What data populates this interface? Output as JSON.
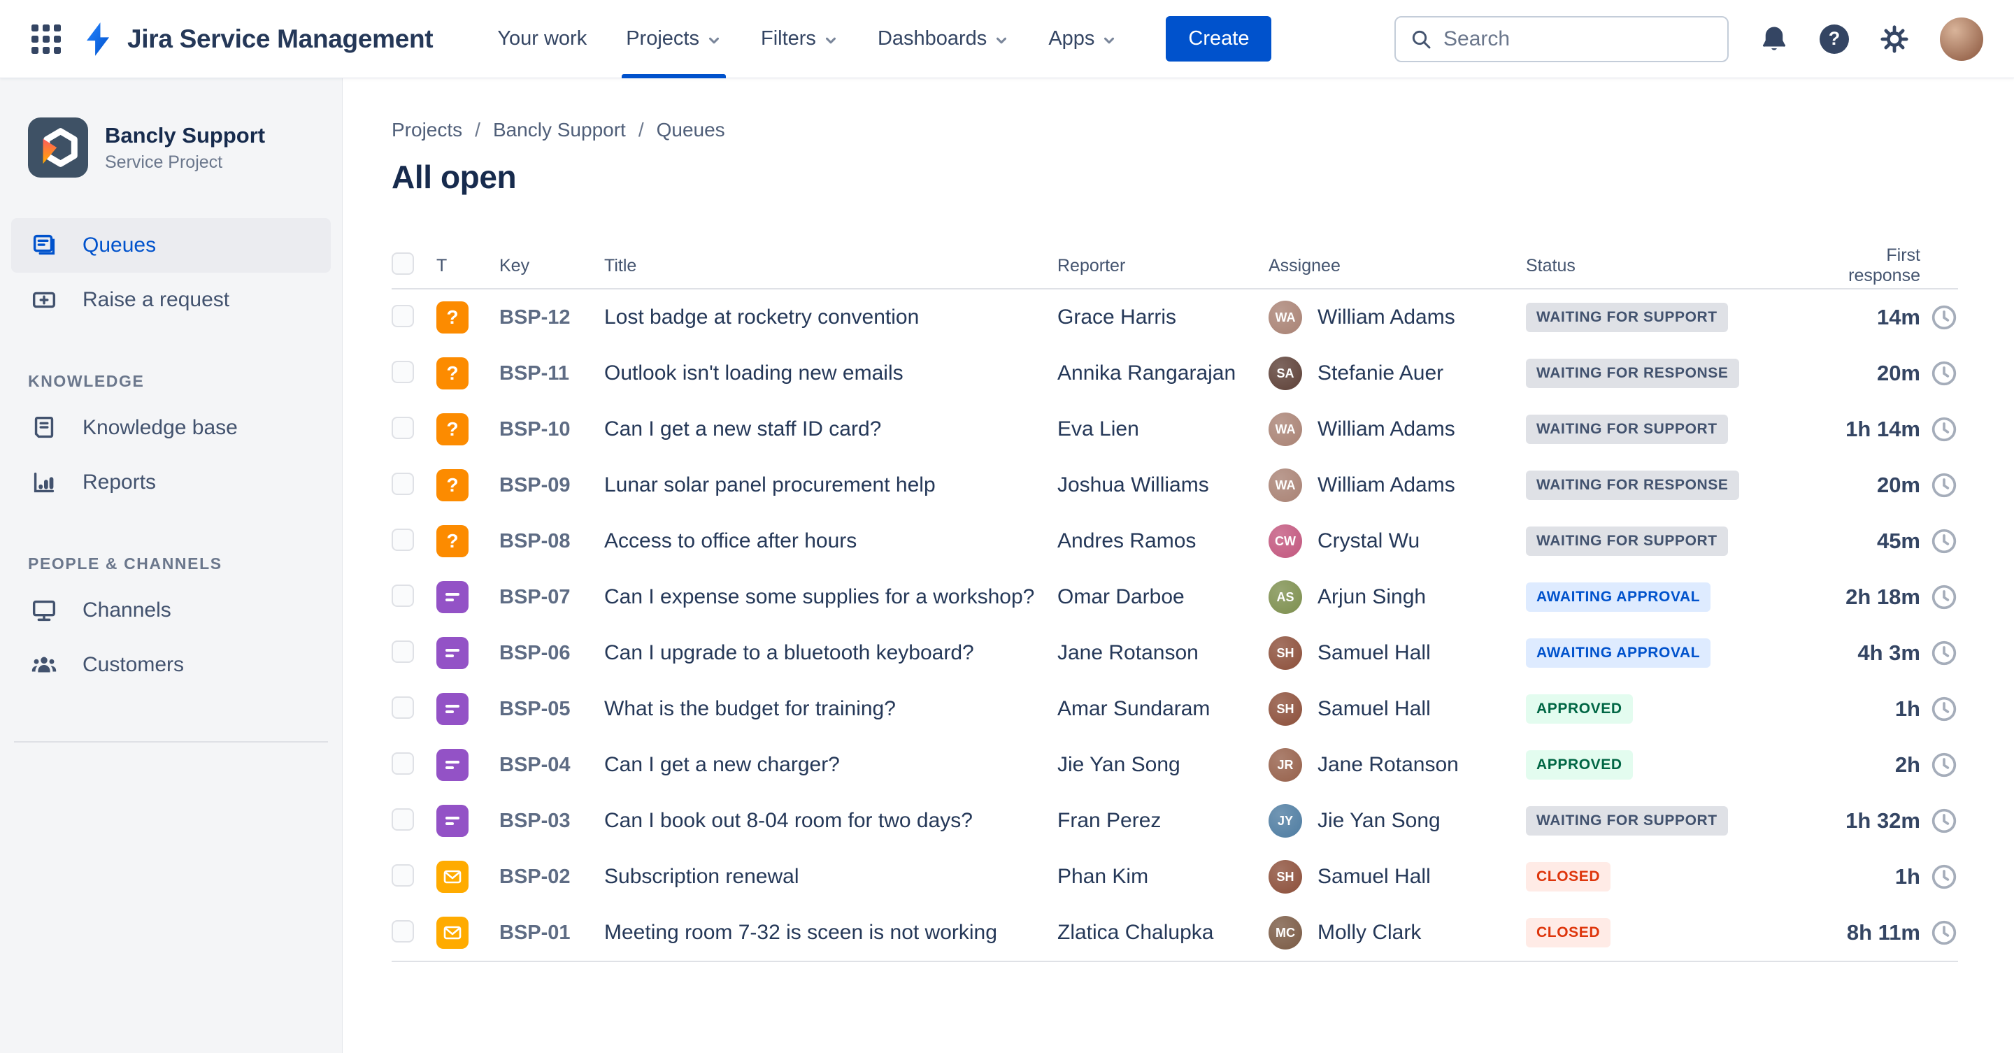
{
  "header": {
    "product": "Jira Service Management",
    "nav": [
      {
        "label": "Your work",
        "chevron": false,
        "active": false
      },
      {
        "label": "Projects",
        "chevron": true,
        "active": true
      },
      {
        "label": "Filters",
        "chevron": true,
        "active": false
      },
      {
        "label": "Dashboards",
        "chevron": true,
        "active": false
      },
      {
        "label": "Apps",
        "chevron": true,
        "active": false
      }
    ],
    "create_label": "Create",
    "search": {
      "placeholder": "Search"
    },
    "icons": [
      "app-switcher-icon",
      "jira-logo",
      "search-icon",
      "notifications-bell-icon",
      "help-icon",
      "settings-gear-icon",
      "user-avatar"
    ]
  },
  "sidebar": {
    "project": {
      "name": "Bancly Support",
      "type": "Service Project"
    },
    "sections": [
      {
        "header": "",
        "items": [
          {
            "label": "Queues",
            "icon": "queues-icon",
            "active": true
          },
          {
            "label": "Raise a request",
            "icon": "raise-request-icon",
            "active": false
          }
        ]
      },
      {
        "header": "KNOWLEDGE",
        "items": [
          {
            "label": "Knowledge base",
            "icon": "knowledge-base-icon",
            "active": false
          },
          {
            "label": "Reports",
            "icon": "reports-icon",
            "active": false
          }
        ]
      },
      {
        "header": "PEOPLE & CHANNELS",
        "items": [
          {
            "label": "Channels",
            "icon": "channels-icon",
            "active": false
          },
          {
            "label": "Customers",
            "icon": "customers-icon",
            "active": false
          }
        ]
      }
    ]
  },
  "main": {
    "breadcrumb": [
      "Projects",
      "Bancly Support",
      "Queues"
    ],
    "title": "All open",
    "table": {
      "columns": [
        "T",
        "Key",
        "Title",
        "Reporter",
        "Assignee",
        "Status",
        "First response"
      ],
      "rows": [
        {
          "type": "question",
          "key": "BSP-12",
          "title": "Lost badge at rocketry convention",
          "reporter": "Grace Harris",
          "assignee": "William Adams",
          "avatar_color": "#A98274",
          "status": "WAITING FOR SUPPORT",
          "status_kind": "gray",
          "first_response": "14m"
        },
        {
          "type": "question",
          "key": "BSP-11",
          "title": "Outlook isn't loading new emails",
          "reporter": "Annika Rangarajan",
          "assignee": "Stefanie Auer",
          "avatar_color": "#5D4037",
          "status": "WAITING FOR RESPONSE",
          "status_kind": "gray",
          "first_response": "20m"
        },
        {
          "type": "question",
          "key": "BSP-10",
          "title": "Can I get a new staff ID card?",
          "reporter": "Eva Lien",
          "assignee": "William Adams",
          "avatar_color": "#A98274",
          "status": "WAITING FOR SUPPORT",
          "status_kind": "gray",
          "first_response": "1h 14m"
        },
        {
          "type": "question",
          "key": "BSP-09",
          "title": "Lunar solar panel procurement help",
          "reporter": "Joshua Williams",
          "assignee": "William Adams",
          "avatar_color": "#A98274",
          "status": "WAITING FOR RESPONSE",
          "status_kind": "gray",
          "first_response": "20m"
        },
        {
          "type": "question",
          "key": "BSP-08",
          "title": "Access to office after hours",
          "reporter": "Andres Ramos",
          "assignee": "Crystal Wu",
          "avatar_color": "#C2577E",
          "status": "WAITING FOR SUPPORT",
          "status_kind": "gray",
          "first_response": "45m"
        },
        {
          "type": "request",
          "key": "BSP-07",
          "title": "Can I expense some supplies for a workshop?",
          "reporter": "Omar Darboe",
          "assignee": "Arjun Singh",
          "avatar_color": "#7D8F4E",
          "status": "AWAITING APPROVAL",
          "status_kind": "blue",
          "first_response": "2h 18m"
        },
        {
          "type": "request",
          "key": "BSP-06",
          "title": "Can I upgrade to a bluetooth keyboard?",
          "reporter": "Jane Rotanson",
          "assignee": "Samuel Hall",
          "avatar_color": "#8C4F3A",
          "status": "AWAITING APPROVAL",
          "status_kind": "blue",
          "first_response": "4h 3m"
        },
        {
          "type": "request",
          "key": "BSP-05",
          "title": "What is the budget for training?",
          "reporter": "Amar Sundaram",
          "assignee": "Samuel Hall",
          "avatar_color": "#8C4F3A",
          "status": "APPROVED",
          "status_kind": "green",
          "first_response": "1h"
        },
        {
          "type": "request",
          "key": "BSP-04",
          "title": "Can I get a new charger?",
          "reporter": "Jie Yan Song",
          "assignee": "Jane Rotanson",
          "avatar_color": "#96604A",
          "status": "APPROVED",
          "status_kind": "green",
          "first_response": "2h"
        },
        {
          "type": "request",
          "key": "BSP-03",
          "title": "Can I book out 8-04 room for two days?",
          "reporter": "Fran Perez",
          "assignee": "Jie Yan Song",
          "avatar_color": "#4E7CA1",
          "status": "WAITING FOR SUPPORT",
          "status_kind": "gray",
          "first_response": "1h 32m"
        },
        {
          "type": "email",
          "key": "BSP-02",
          "title": "Subscription renewal",
          "reporter": "Phan Kim",
          "assignee": "Samuel Hall",
          "avatar_color": "#8C4F3A",
          "status": "CLOSED",
          "status_kind": "red",
          "first_response": "1h"
        },
        {
          "type": "email",
          "key": "BSP-01",
          "title": "Meeting room 7-32 is sceen is not working",
          "reporter": "Zlatica Chalupka",
          "assignee": "Molly Clark",
          "avatar_color": "#7A5A44",
          "status": "CLOSED",
          "status_kind": "red",
          "first_response": "8h 11m"
        }
      ]
    }
  },
  "colors": {
    "accent_blue": "#0052CC",
    "type_question": "#FC8B00",
    "type_request": "#9352C6",
    "type_email": "#FFAB00",
    "badge_gray_bg": "#DFE1E6",
    "badge_blue_bg": "#DEEBFF",
    "badge_green_bg": "#E3FCEF",
    "badge_red_bg": "#FFEBE6",
    "badge_red_text": "#DE350B",
    "badge_green_text": "#006644"
  }
}
